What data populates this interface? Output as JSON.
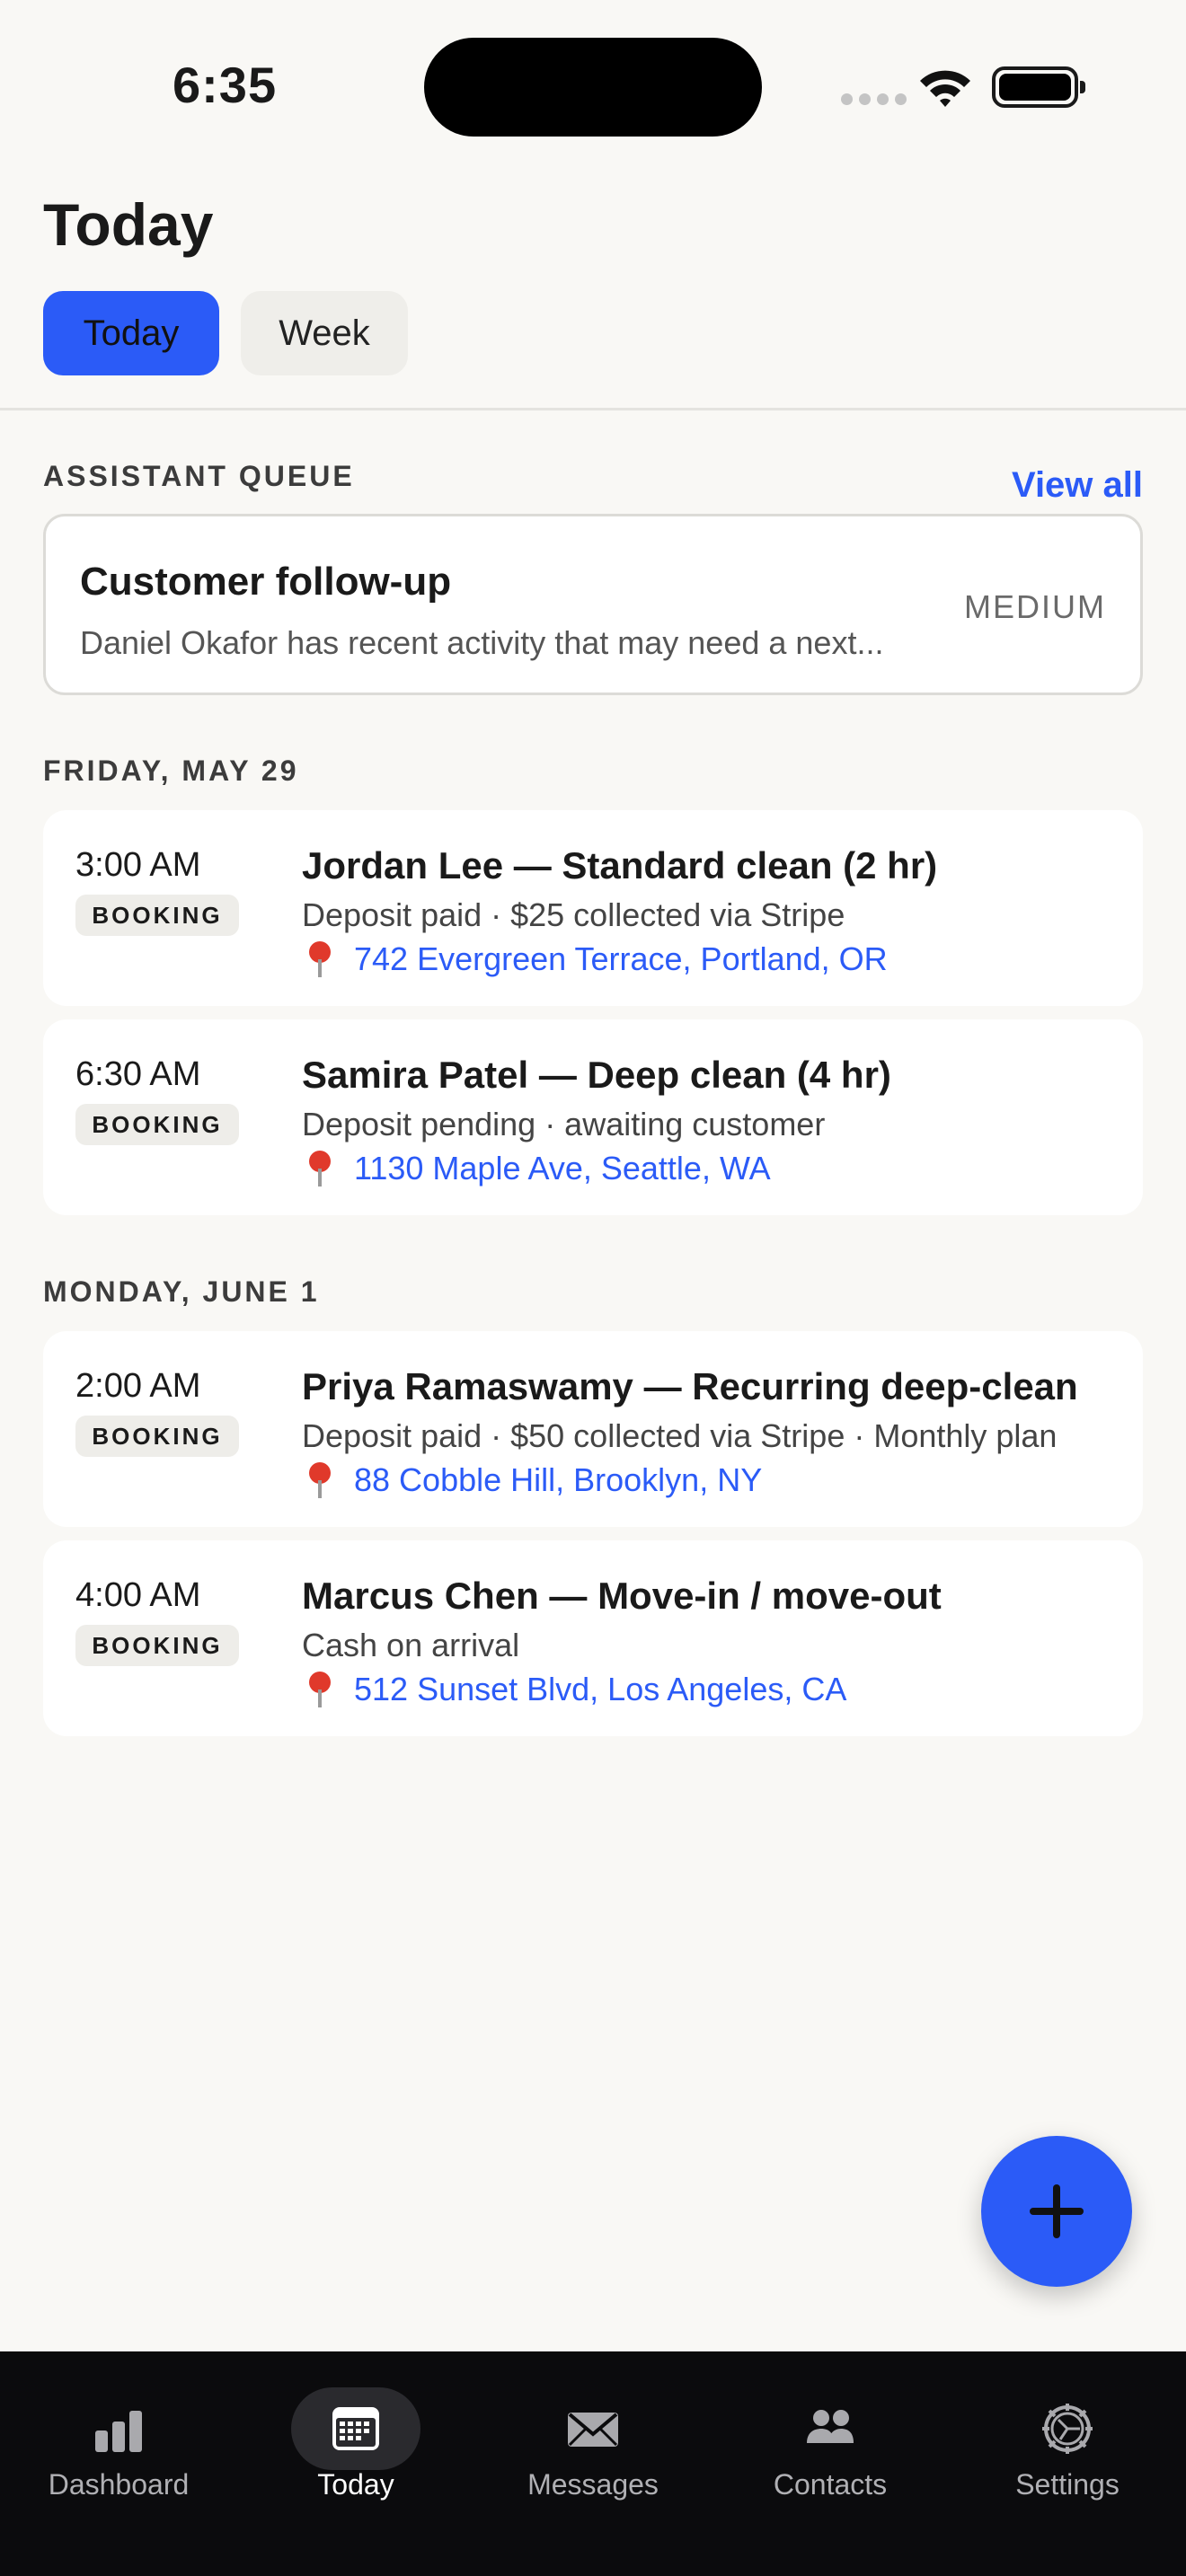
{
  "status_bar": {
    "time": "6:35"
  },
  "header": {
    "title": "Today",
    "segments": [
      {
        "label": "Today",
        "selected": true
      },
      {
        "label": "Week",
        "selected": false
      }
    ]
  },
  "assistant_queue": {
    "section_label": "ASSISTANT QUEUE",
    "view_all_label": "View all",
    "card": {
      "title": "Customer follow-up",
      "description": "Daniel Okafor has recent activity that may need a next...",
      "priority": "MEDIUM"
    }
  },
  "days": [
    {
      "label": "FRIDAY, MAY 29",
      "bookings": [
        {
          "time": "3:00 AM",
          "badge": "BOOKING",
          "title": "Jordan Lee — Standard clean (2 hr)",
          "detail": "Deposit paid · $25 collected via Stripe",
          "address": "742 Evergreen Terrace, Portland, OR"
        },
        {
          "time": "6:30 AM",
          "badge": "BOOKING",
          "title": "Samira Patel — Deep clean (4 hr)",
          "detail": "Deposit pending · awaiting customer",
          "address": "1130 Maple Ave, Seattle, WA"
        }
      ]
    },
    {
      "label": "MONDAY, JUNE 1",
      "bookings": [
        {
          "time": "2:00 AM",
          "badge": "BOOKING",
          "title": "Priya Ramaswamy — Recurring deep-clean",
          "detail": "Deposit paid · $50 collected via Stripe · Monthly plan",
          "address": "88 Cobble Hill, Brooklyn, NY"
        },
        {
          "time": "4:00 AM",
          "badge": "BOOKING",
          "title": "Marcus Chen — Move-in / move-out",
          "detail": "Cash on arrival",
          "address": "512 Sunset Blvd, Los Angeles, CA"
        }
      ]
    }
  ],
  "tab_bar": {
    "tabs": [
      {
        "label": "Dashboard",
        "icon": "bar-chart-icon",
        "active": false
      },
      {
        "label": "Today",
        "icon": "calendar-icon",
        "active": true
      },
      {
        "label": "Messages",
        "icon": "envelope-icon",
        "active": false
      },
      {
        "label": "Contacts",
        "icon": "people-icon",
        "active": false
      },
      {
        "label": "Settings",
        "icon": "gear-icon",
        "active": false
      }
    ]
  },
  "colors": {
    "accent": "#2b5bf7",
    "background": "#f9f8f5",
    "tab_bar": "#0b0b0d"
  }
}
